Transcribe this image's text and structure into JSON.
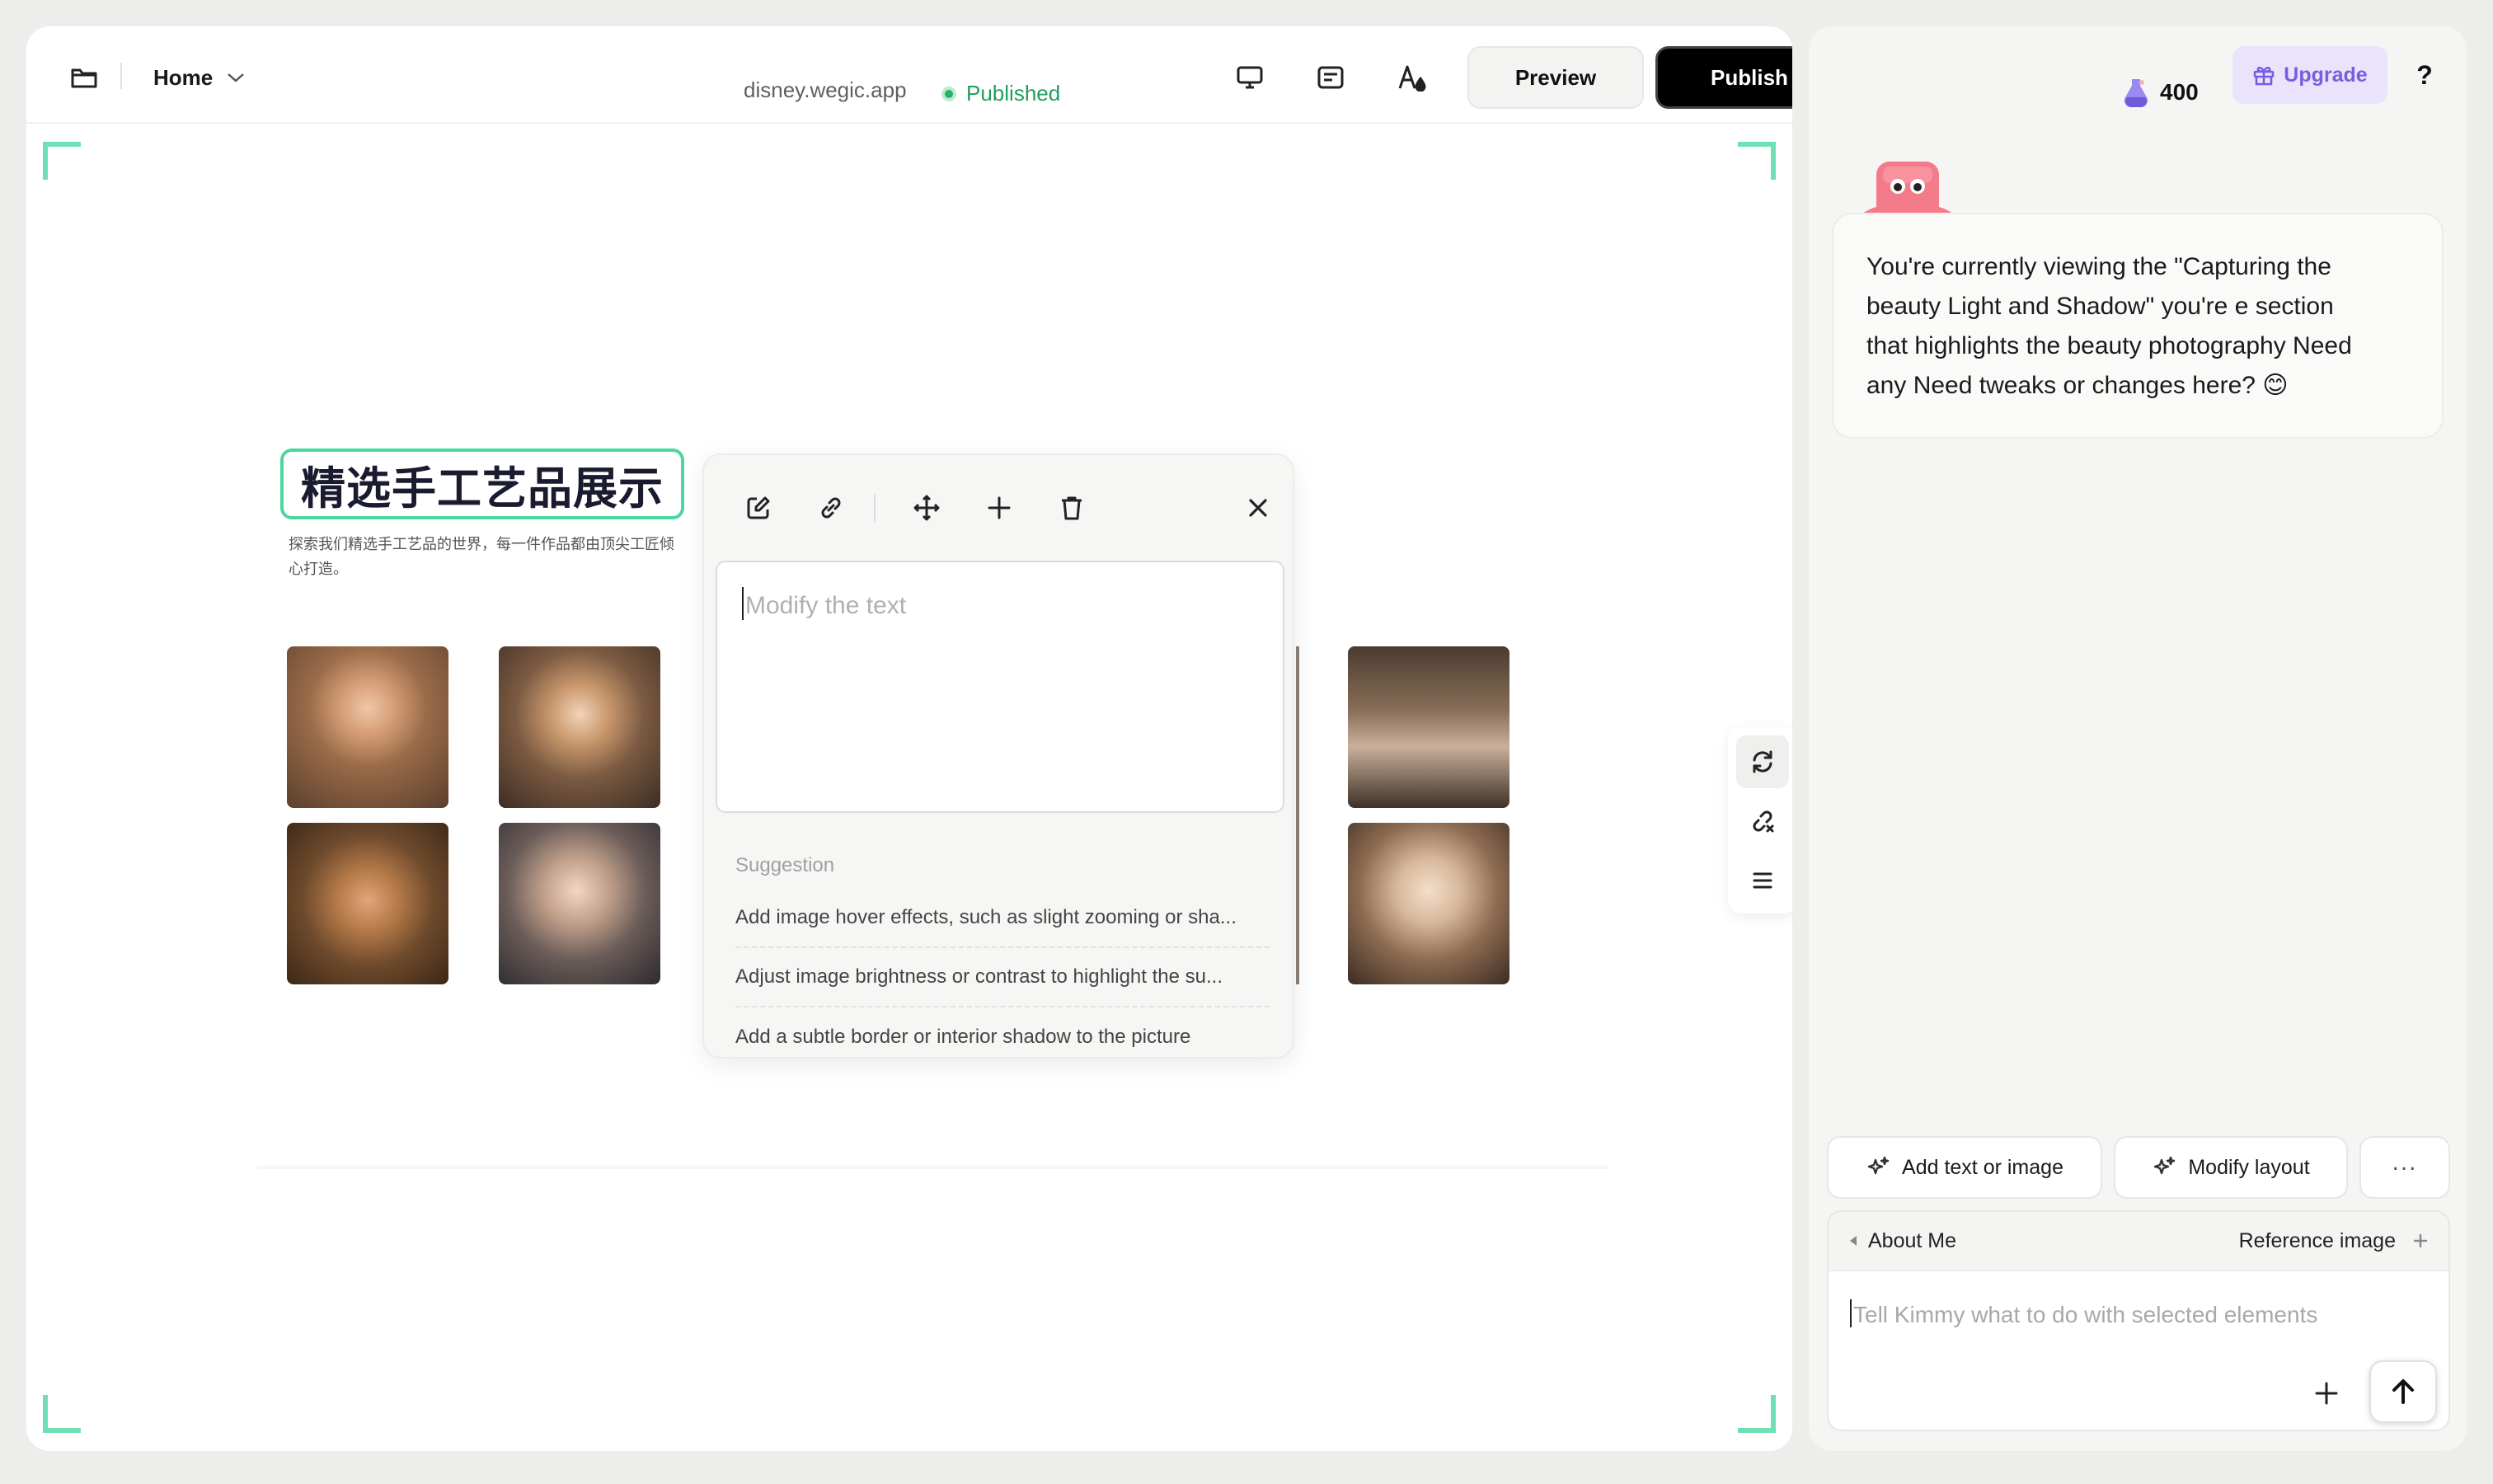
{
  "topbar": {
    "page_selector": "Home",
    "domain": "disney.wegic.app",
    "status": "Published",
    "preview_label": "Preview",
    "publish_label": "Publish",
    "icons": [
      "folder-icon",
      "desktop-icon",
      "form-icon",
      "font-color-icon",
      "settings-icon"
    ]
  },
  "canvas": {
    "section_title": "精选手工艺品展示",
    "section_desc": "探索我们精选手工艺品的世界，每一件作品都由顶尖工匠倾心打造。",
    "photos": [
      "portrait-1",
      "portrait-2",
      "portrait-3",
      "portrait-4",
      "bedroom",
      "portrait-5"
    ]
  },
  "edit_popover": {
    "placeholder": "Modify the text",
    "suggestion_label": "Suggestion",
    "suggestions": [
      "Add image hover effects, such as slight zooming or sha...",
      "Adjust image brightness or contrast to highlight the su...",
      "Add a subtle border or interior shadow to the picture"
    ],
    "tools": [
      "edit-icon",
      "link-icon",
      "move-icon",
      "plus-icon",
      "trash-icon",
      "close-icon"
    ]
  },
  "side_tools": [
    "swap-icon",
    "unlink-icon",
    "menu-icon"
  ],
  "assistant": {
    "credits": "400",
    "upgrade_label": "Upgrade",
    "help_label": "?",
    "message_lines": [
      "You're currently viewing the \"Capturing the",
      "beauty  Light and Shadow\" you're e section",
      "that highlights the beauty photography  Need",
      "any Need  tweaks or changes here? 😊"
    ],
    "quick_actions": [
      "Add text or image",
      "Modify layout",
      "..."
    ],
    "context_tag": "About Me",
    "reference_label": "Reference image",
    "input_placeholder": "Tell Kimmy what to do with selected elements"
  },
  "colors": {
    "accent_green": "#4cd79f",
    "published_green": "#1f9e5d",
    "upgrade_purple": "#7b5ce0",
    "mascot_pink": "#f47b8a"
  }
}
